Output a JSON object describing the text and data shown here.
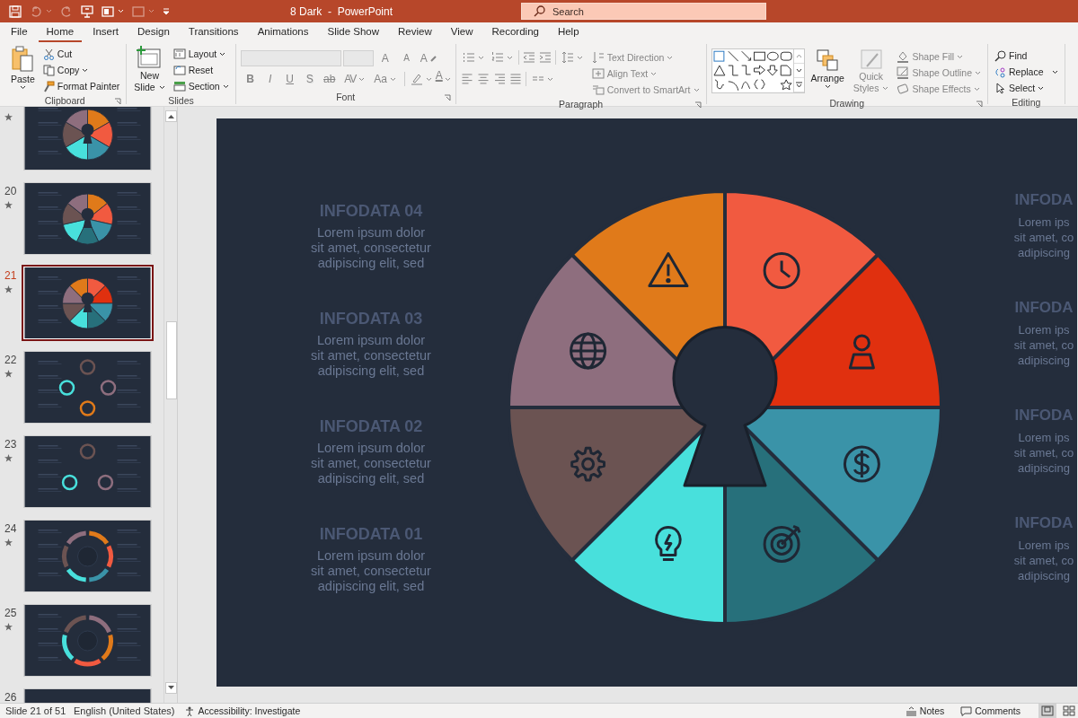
{
  "title_bar": {
    "title": "8 Dark  -  PowerPoint"
  },
  "quick_access": [
    {
      "disabled": false
    },
    {
      "disabled": true
    },
    {
      "disabled": true
    },
    {
      "disabled": false
    },
    {
      "disabled": false
    },
    {
      "disabled": true
    }
  ],
  "search": {
    "placeholder": "Search"
  },
  "tabs": [
    {
      "label": "File",
      "selected": false
    },
    {
      "label": "Home",
      "selected": true
    },
    {
      "label": "Insert",
      "selected": false
    },
    {
      "label": "Design",
      "selected": false
    },
    {
      "label": "Transitions",
      "selected": false
    },
    {
      "label": "Animations",
      "selected": false
    },
    {
      "label": "Slide Show",
      "selected": false
    },
    {
      "label": "Review",
      "selected": false
    },
    {
      "label": "View",
      "selected": false
    },
    {
      "label": "Recording",
      "selected": false
    },
    {
      "label": "Help",
      "selected": false
    }
  ],
  "ribbon": {
    "clipboard": {
      "label": "Clipboard",
      "paste": "Paste",
      "cut": "Cut",
      "copy": "Copy",
      "format_painter": "Format Painter"
    },
    "slides": {
      "label": "Slides",
      "new_slide": [
        "New",
        "Slide"
      ],
      "layout": "Layout",
      "reset": "Reset",
      "section": "Section"
    },
    "font": {
      "label": "Font",
      "disabled": true,
      "grow": "A",
      "shrink": "A",
      "clear_format": "A",
      "styles": [
        "B",
        "I",
        "U",
        "S",
        "ab",
        "AV",
        "Aa"
      ],
      "font_color": "A"
    },
    "paragraph": {
      "label": "Paragraph",
      "disabled": true,
      "text_direction": "Text Direction",
      "align_text": "Align Text",
      "convert_smartart": "Convert to SmartArt"
    },
    "drawing": {
      "label": "Drawing",
      "arrange": "Arrange",
      "quick_styles": [
        "Quick",
        "Styles"
      ],
      "quick_styles_disabled": true,
      "shape_fill": "Shape Fill",
      "shape_outline": "Shape Outline",
      "shape_effects": "Shape Effects",
      "shape_format_disabled": true
    },
    "editing": {
      "label": "Editing",
      "find": "Find",
      "replace": "Replace",
      "select": "Select"
    }
  },
  "thumbnails": [
    {
      "kind": "wheel",
      "selected": false,
      "animated": true,
      "segments": [
        {
          "color": "#e07a1a"
        },
        {
          "color": "#f15a40"
        },
        {
          "color": "#3a93a8"
        },
        {
          "color": "#48e0dc"
        },
        {
          "color": "#6b5352"
        },
        {
          "color": "#8e6e7e"
        }
      ]
    },
    {
      "number": "20",
      "kind": "wheel",
      "selected": false,
      "animated": true,
      "segments": [
        {
          "color": "#e07a1a"
        },
        {
          "color": "#f15a40"
        },
        {
          "color": "#3a93a8"
        },
        {
          "color": "#27707b"
        },
        {
          "color": "#48e0dc"
        },
        {
          "color": "#6b5352"
        },
        {
          "color": "#8e6e7e"
        }
      ]
    },
    {
      "number": "21",
      "kind": "wheel",
      "selected": true,
      "animated": true,
      "segments": [
        {
          "color": "#f15a40"
        },
        {
          "color": "#e0300f"
        },
        {
          "color": "#3a93a8"
        },
        {
          "color": "#27707b"
        },
        {
          "color": "#48e0dc"
        },
        {
          "color": "#6b5352"
        },
        {
          "color": "#8e6e7e"
        },
        {
          "color": "#e07a1a"
        }
      ]
    },
    {
      "number": "22",
      "kind": "rings",
      "selected": false,
      "animated": true,
      "segments": [
        {
          "color": "#6b5352"
        },
        {
          "color": "#8e6e7e"
        },
        {
          "color": "#e07a1a"
        },
        {
          "color": "#48e0dc"
        }
      ]
    },
    {
      "number": "23",
      "kind": "rings",
      "selected": false,
      "animated": true,
      "segments": [
        {
          "color": "#6b5352"
        },
        {
          "color": "#8e6e7e"
        },
        {
          "color": "#48e0dc"
        }
      ]
    },
    {
      "number": "24",
      "kind": "arcs",
      "selected": false,
      "animated": true,
      "segments": [
        {
          "color": "#e07a1a"
        },
        {
          "color": "#f15a40"
        },
        {
          "color": "#3a93a8"
        },
        {
          "color": "#48e0dc"
        },
        {
          "color": "#6b5352"
        },
        {
          "color": "#8e6e7e"
        }
      ]
    },
    {
      "number": "25",
      "kind": "arcs",
      "selected": false,
      "animated": true,
      "segments": [
        {
          "color": "#8e6e7e"
        },
        {
          "color": "#e07a1a"
        },
        {
          "color": "#f15a40"
        },
        {
          "color": "#48e0dc"
        },
        {
          "color": "#6b5352"
        }
      ]
    },
    {
      "number": "26",
      "kind": "blank",
      "selected": false
    }
  ],
  "slide": {
    "left_blocks": [
      {
        "title": "INFODATA 04",
        "body": "Lorem ipsum dolor\nsit amet, consectetur\nadipiscing elit, sed"
      },
      {
        "title": "INFODATA 03",
        "body": "Lorem ipsum dolor\nsit amet, consectetur\nadipiscing elit, sed"
      },
      {
        "title": "INFODATA 02",
        "body": "Lorem ipsum dolor\nsit amet, consectetur\nadipiscing elit, sed"
      },
      {
        "title": "INFODATA 01",
        "body": "Lorem ipsum dolor\nsit amet, consectetur\nadipiscing elit, sed"
      }
    ],
    "right_blocks": [
      {
        "title": "INFODA",
        "body": "Lorem ips\nsit amet, co\nadipiscing"
      },
      {
        "title": "INFODA",
        "body": "Lorem ips\nsit amet, co\nadipiscing"
      },
      {
        "title": "INFODA",
        "body": "Lorem ips\nsit amet, co\nadipiscing"
      },
      {
        "title": "INFODA",
        "body": "Lorem ips\nsit amet, co\nadipiscing"
      }
    ],
    "segments": [
      {
        "color": "#f15a40"
      },
      {
        "color": "#e0300f"
      },
      {
        "color": "#3a93a8"
      },
      {
        "color": "#27707b"
      },
      {
        "color": "#48e0dc"
      },
      {
        "color": "#6b5352"
      },
      {
        "color": "#8e6e7e"
      },
      {
        "color": "#e07a1a"
      }
    ]
  },
  "status_bar": {
    "slide": "Slide 21 of 51",
    "language": "English (United States)",
    "accessibility": "Accessibility: Investigate",
    "notes": "Notes",
    "comments": "Comments",
    "views": [
      {
        "selected": true
      },
      {
        "selected": false
      }
    ]
  }
}
